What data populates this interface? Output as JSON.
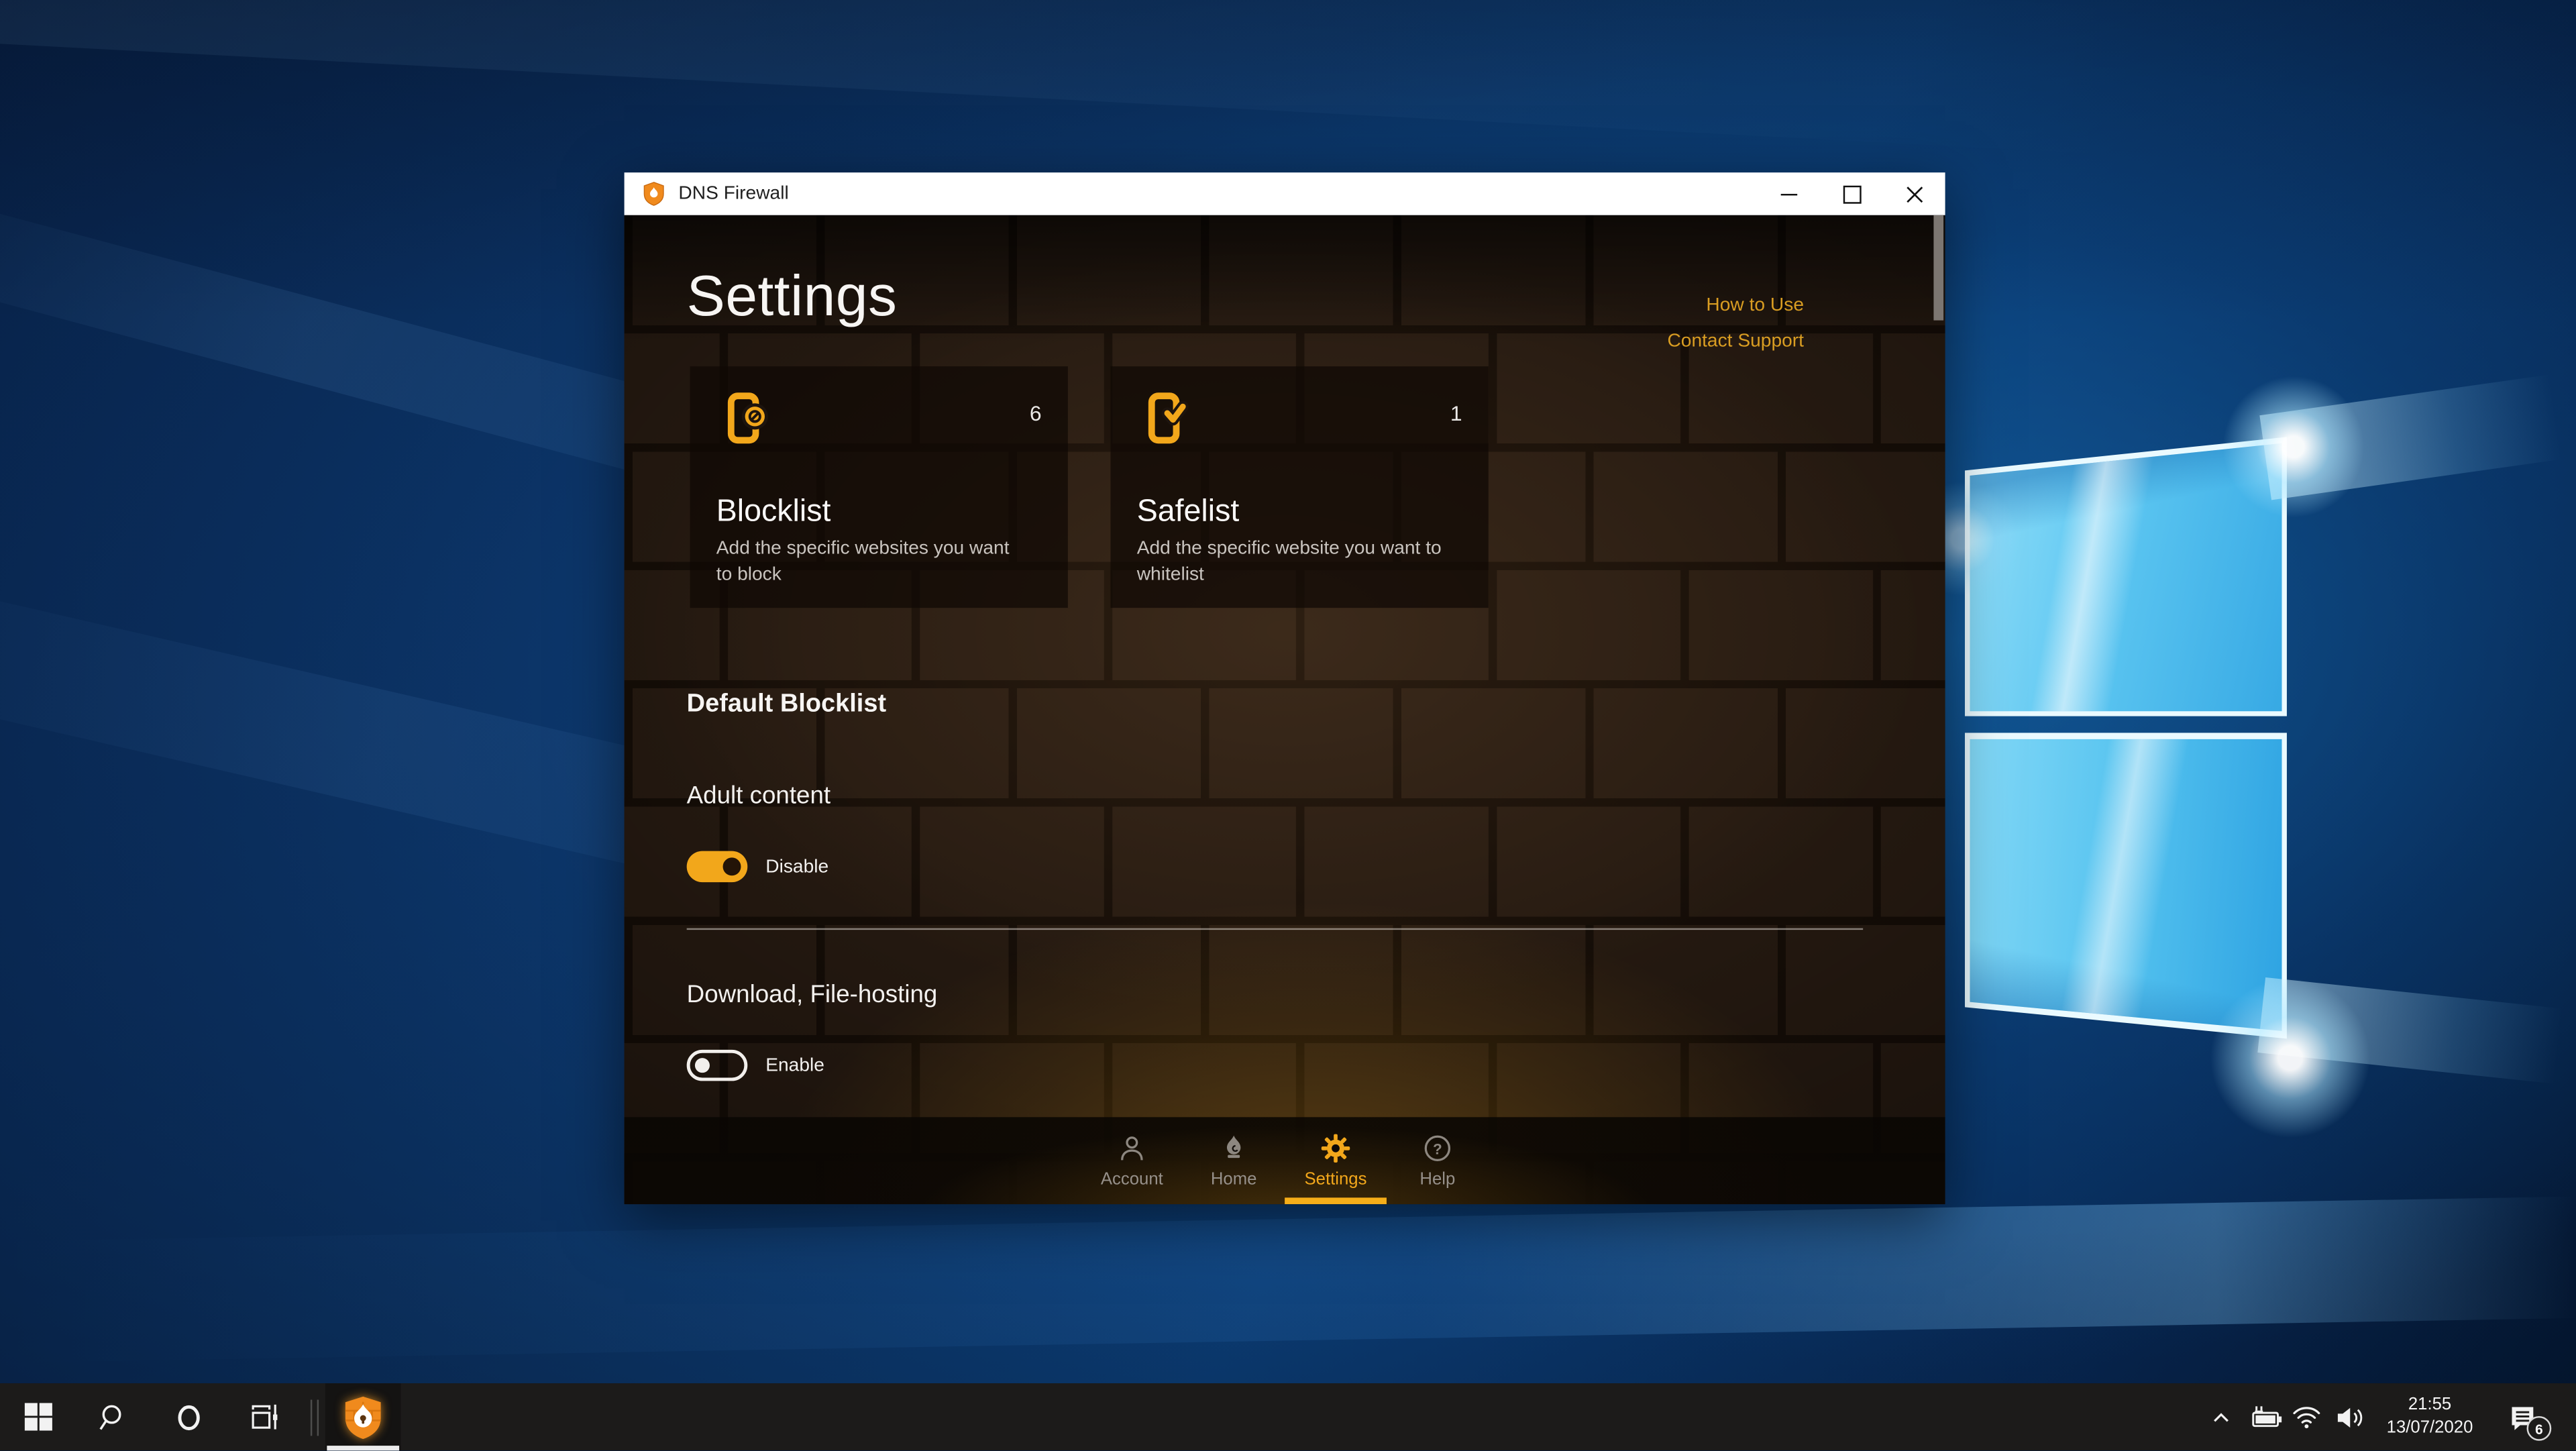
{
  "window": {
    "title": "DNS Firewall",
    "page_title": "Settings",
    "links": [
      {
        "label": "How to Use"
      },
      {
        "label": "Contact Support"
      }
    ],
    "cards": [
      {
        "icon": "phone-blocked-icon",
        "count": "6",
        "title": "Blocklist",
        "description": "Add the specific websites you want to block"
      },
      {
        "icon": "phone-check-icon",
        "count": "1",
        "title": "Safelist",
        "description": "Add the specific website you want to whitelist"
      }
    ],
    "default_blocklist": {
      "heading": "Default Blocklist",
      "items": [
        {
          "label": "Adult content",
          "state": "on",
          "action_label": "Disable"
        },
        {
          "label": "Download, File-hosting",
          "state": "off",
          "action_label": "Enable"
        }
      ]
    },
    "nav": {
      "tabs": [
        {
          "label": "Account",
          "icon": "person-icon",
          "active": false
        },
        {
          "label": "Home",
          "icon": "flame-icon",
          "active": false
        },
        {
          "label": "Settings",
          "icon": "gear-icon",
          "active": true
        },
        {
          "label": "Help",
          "icon": "help-icon",
          "active": false
        }
      ]
    }
  },
  "taskbar": {
    "clock": {
      "time": "21:55",
      "date": "13/07/2020"
    },
    "notification_badge": "6"
  },
  "colors": {
    "accent_amber": "#f2a71b",
    "link_amber": "#d99d22",
    "titlebar_bg": "#ffffff",
    "content_brick": "#261a11",
    "taskbar_bg": "#1c1b1a",
    "wallpaper_blue": "#0d3a70",
    "logo_blue": "#54c2ef",
    "app_icon_orange": "#f08a1d"
  }
}
